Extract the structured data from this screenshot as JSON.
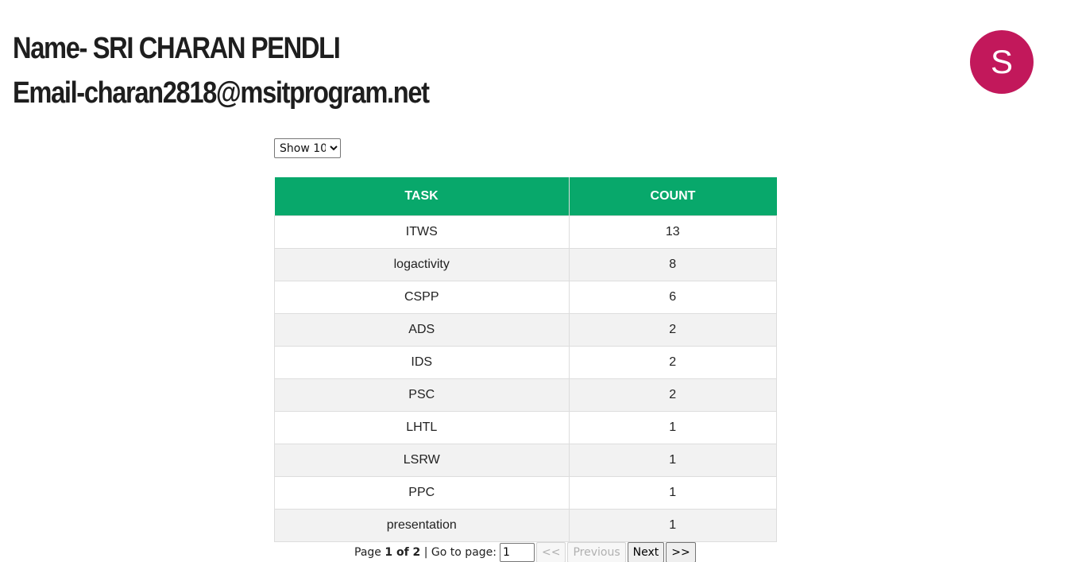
{
  "profile": {
    "name_line": "Name- SRI CHARAN PENDLI",
    "email_line": "Email-charan2818@msitprogram.net",
    "avatar_letter": "S",
    "avatar_color": "#c2185b"
  },
  "page_size": {
    "selected": "Show 10"
  },
  "table": {
    "header_color": "#08a86b",
    "columns": [
      "TASK",
      "COUNT"
    ],
    "rows": [
      {
        "task": "ITWS",
        "count": "13"
      },
      {
        "task": "logactivity",
        "count": "8"
      },
      {
        "task": "CSPP",
        "count": "6"
      },
      {
        "task": "ADS",
        "count": "2"
      },
      {
        "task": "IDS",
        "count": "2"
      },
      {
        "task": "PSC",
        "count": "2"
      },
      {
        "task": "LHTL",
        "count": "1"
      },
      {
        "task": "LSRW",
        "count": "1"
      },
      {
        "task": "PPC",
        "count": "1"
      },
      {
        "task": "presentation",
        "count": "1"
      }
    ]
  },
  "pagination": {
    "page_prefix": "Page",
    "page_indicator": "1 of 2",
    "goto_label": "| Go to page:",
    "goto_value": "1",
    "first_label": "<<",
    "previous_label": "Previous",
    "next_label": "Next",
    "last_label": ">>"
  }
}
